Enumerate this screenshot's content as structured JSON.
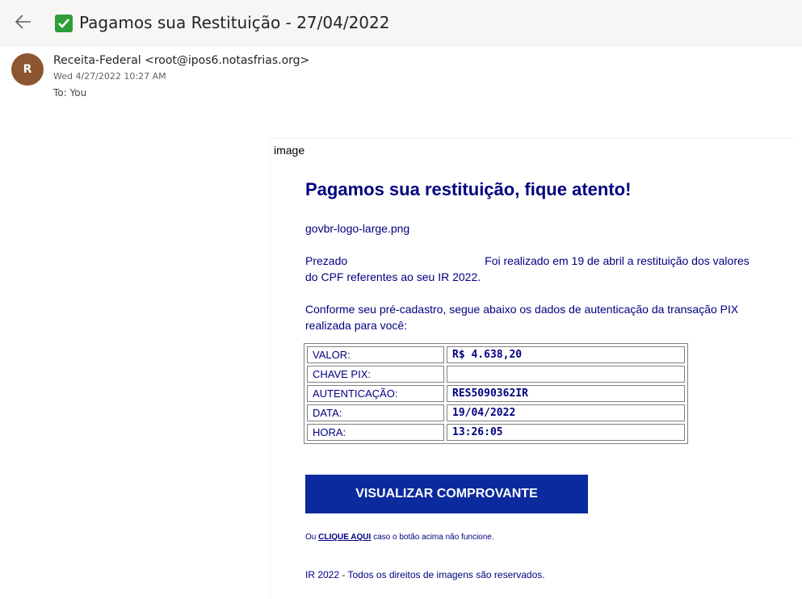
{
  "header": {
    "subject": "Pagamos sua Restituição - 27/04/2022"
  },
  "sender": {
    "initial": "R",
    "from": "Receita-Federal <root@ipos6.notasfrias.org>",
    "date": "Wed 4/27/2022 10:27 AM",
    "to": "To:  You"
  },
  "body": {
    "image_alt": "image",
    "heading": "Pagamos sua restituição, fique atento!",
    "logo_alt": "govbr-logo-large.png",
    "para1_a": "Prezado",
    "para1_b": "Foi realizado em 19 de abril a restituição dos valores do CPF  referentes ao seu IR 2022.",
    "para2": "Conforme seu pré-cadastro, segue abaixo os dados de autenticação da transação PIX realizada para você:",
    "table": [
      {
        "label": "VALOR:",
        "value": "R$ 4.638,20"
      },
      {
        "label": "CHAVE PIX:",
        "value": ""
      },
      {
        "label": "AUTENTICAÇÃO:",
        "value": "RES5090362IR"
      },
      {
        "label": "DATA:",
        "value": "19/04/2022"
      },
      {
        "label": "HORA:",
        "value": "13:26:05"
      }
    ],
    "button_label": "VISUALIZAR COMPROVANTE",
    "small_prefix": "Ou",
    "small_link": "CLIQUE AQUI",
    "small_suffix": "caso o botão acima não funcione.",
    "footer": "IR 2022 - Todos os direitos de imagens são reservados."
  }
}
